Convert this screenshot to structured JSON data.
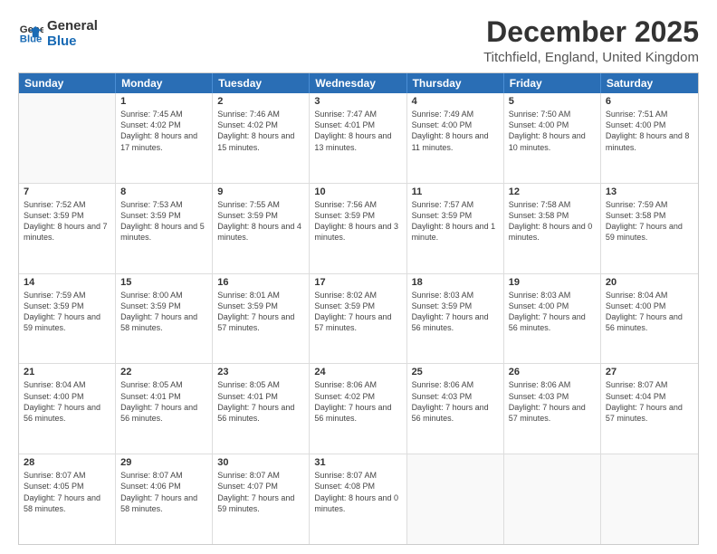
{
  "logo": {
    "line1": "General",
    "line2": "Blue"
  },
  "title": "December 2025",
  "subtitle": "Titchfield, England, United Kingdom",
  "header_days": [
    "Sunday",
    "Monday",
    "Tuesday",
    "Wednesday",
    "Thursday",
    "Friday",
    "Saturday"
  ],
  "weeks": [
    [
      {
        "date": "",
        "info": ""
      },
      {
        "date": "1",
        "info": "Sunrise: 7:45 AM\nSunset: 4:02 PM\nDaylight: 8 hours\nand 17 minutes."
      },
      {
        "date": "2",
        "info": "Sunrise: 7:46 AM\nSunset: 4:02 PM\nDaylight: 8 hours\nand 15 minutes."
      },
      {
        "date": "3",
        "info": "Sunrise: 7:47 AM\nSunset: 4:01 PM\nDaylight: 8 hours\nand 13 minutes."
      },
      {
        "date": "4",
        "info": "Sunrise: 7:49 AM\nSunset: 4:00 PM\nDaylight: 8 hours\nand 11 minutes."
      },
      {
        "date": "5",
        "info": "Sunrise: 7:50 AM\nSunset: 4:00 PM\nDaylight: 8 hours\nand 10 minutes."
      },
      {
        "date": "6",
        "info": "Sunrise: 7:51 AM\nSunset: 4:00 PM\nDaylight: 8 hours\nand 8 minutes."
      }
    ],
    [
      {
        "date": "7",
        "info": "Sunrise: 7:52 AM\nSunset: 3:59 PM\nDaylight: 8 hours\nand 7 minutes."
      },
      {
        "date": "8",
        "info": "Sunrise: 7:53 AM\nSunset: 3:59 PM\nDaylight: 8 hours\nand 5 minutes."
      },
      {
        "date": "9",
        "info": "Sunrise: 7:55 AM\nSunset: 3:59 PM\nDaylight: 8 hours\nand 4 minutes."
      },
      {
        "date": "10",
        "info": "Sunrise: 7:56 AM\nSunset: 3:59 PM\nDaylight: 8 hours\nand 3 minutes."
      },
      {
        "date": "11",
        "info": "Sunrise: 7:57 AM\nSunset: 3:59 PM\nDaylight: 8 hours\nand 1 minute."
      },
      {
        "date": "12",
        "info": "Sunrise: 7:58 AM\nSunset: 3:58 PM\nDaylight: 8 hours\nand 0 minutes."
      },
      {
        "date": "13",
        "info": "Sunrise: 7:59 AM\nSunset: 3:58 PM\nDaylight: 7 hours\nand 59 minutes."
      }
    ],
    [
      {
        "date": "14",
        "info": "Sunrise: 7:59 AM\nSunset: 3:59 PM\nDaylight: 7 hours\nand 59 minutes."
      },
      {
        "date": "15",
        "info": "Sunrise: 8:00 AM\nSunset: 3:59 PM\nDaylight: 7 hours\nand 58 minutes."
      },
      {
        "date": "16",
        "info": "Sunrise: 8:01 AM\nSunset: 3:59 PM\nDaylight: 7 hours\nand 57 minutes."
      },
      {
        "date": "17",
        "info": "Sunrise: 8:02 AM\nSunset: 3:59 PM\nDaylight: 7 hours\nand 57 minutes."
      },
      {
        "date": "18",
        "info": "Sunrise: 8:03 AM\nSunset: 3:59 PM\nDaylight: 7 hours\nand 56 minutes."
      },
      {
        "date": "19",
        "info": "Sunrise: 8:03 AM\nSunset: 4:00 PM\nDaylight: 7 hours\nand 56 minutes."
      },
      {
        "date": "20",
        "info": "Sunrise: 8:04 AM\nSunset: 4:00 PM\nDaylight: 7 hours\nand 56 minutes."
      }
    ],
    [
      {
        "date": "21",
        "info": "Sunrise: 8:04 AM\nSunset: 4:00 PM\nDaylight: 7 hours\nand 56 minutes."
      },
      {
        "date": "22",
        "info": "Sunrise: 8:05 AM\nSunset: 4:01 PM\nDaylight: 7 hours\nand 56 minutes."
      },
      {
        "date": "23",
        "info": "Sunrise: 8:05 AM\nSunset: 4:01 PM\nDaylight: 7 hours\nand 56 minutes."
      },
      {
        "date": "24",
        "info": "Sunrise: 8:06 AM\nSunset: 4:02 PM\nDaylight: 7 hours\nand 56 minutes."
      },
      {
        "date": "25",
        "info": "Sunrise: 8:06 AM\nSunset: 4:03 PM\nDaylight: 7 hours\nand 56 minutes."
      },
      {
        "date": "26",
        "info": "Sunrise: 8:06 AM\nSunset: 4:03 PM\nDaylight: 7 hours\nand 57 minutes."
      },
      {
        "date": "27",
        "info": "Sunrise: 8:07 AM\nSunset: 4:04 PM\nDaylight: 7 hours\nand 57 minutes."
      }
    ],
    [
      {
        "date": "28",
        "info": "Sunrise: 8:07 AM\nSunset: 4:05 PM\nDaylight: 7 hours\nand 58 minutes."
      },
      {
        "date": "29",
        "info": "Sunrise: 8:07 AM\nSunset: 4:06 PM\nDaylight: 7 hours\nand 58 minutes."
      },
      {
        "date": "30",
        "info": "Sunrise: 8:07 AM\nSunset: 4:07 PM\nDaylight: 7 hours\nand 59 minutes."
      },
      {
        "date": "31",
        "info": "Sunrise: 8:07 AM\nSunset: 4:08 PM\nDaylight: 8 hours\nand 0 minutes."
      },
      {
        "date": "",
        "info": ""
      },
      {
        "date": "",
        "info": ""
      },
      {
        "date": "",
        "info": ""
      }
    ]
  ]
}
